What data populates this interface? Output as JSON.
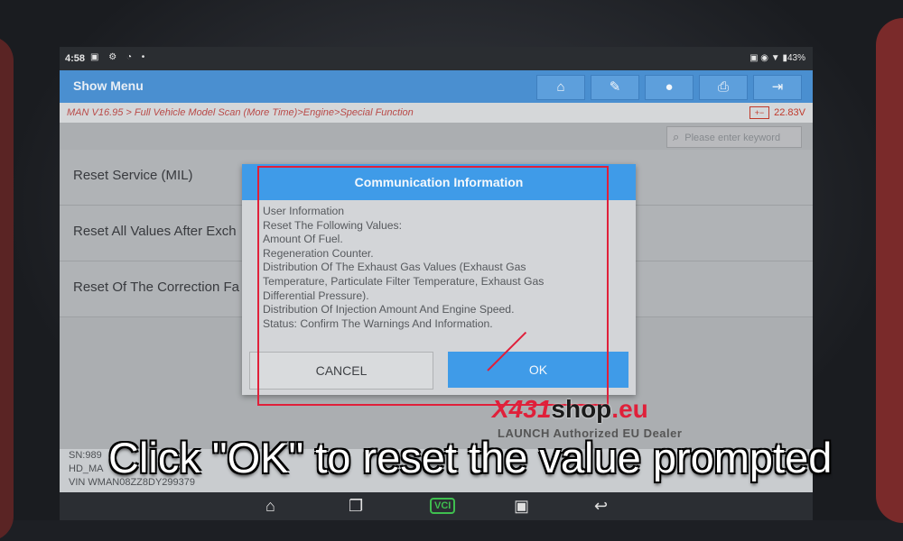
{
  "status_bar": {
    "time": "4:58",
    "left_icons": "▣ ⚙ ◔ •",
    "right_icons": "▣ ◉ ▼ ▮43%"
  },
  "header": {
    "title": "Show Menu",
    "buttons": [
      {
        "icon": "home-icon",
        "glyph": "⌂"
      },
      {
        "icon": "edit-report-icon",
        "glyph": "✎"
      },
      {
        "icon": "chat-icon",
        "glyph": "●"
      },
      {
        "icon": "print-icon",
        "glyph": "⎙"
      },
      {
        "icon": "exit-icon",
        "glyph": "⇥"
      }
    ]
  },
  "breadcrumb": {
    "path": "MAN V16.95 > Full Vehicle Model Scan (More Time)>Engine>Special Function",
    "battery_label": "+−",
    "voltage": "22.83V"
  },
  "search": {
    "placeholder": "Please enter keyword"
  },
  "menu_items": [
    {
      "label": "Reset Service (MIL)"
    },
    {
      "label": "Reset All Values After Exch"
    },
    {
      "label": "Reset Of The Correction Fa"
    }
  ],
  "vehicle_info": {
    "sn": "SN:989",
    "hd": "HD_MA",
    "vin": "VIN WMAN08ZZ8DY299379"
  },
  "dialog": {
    "title": "Communication Information",
    "lines": [
      "User Information",
      "Reset The Following Values:",
      "Amount Of Fuel.",
      "Regeneration Counter.",
      "Distribution Of The Exhaust Gas Values (Exhaust Gas",
      "Temperature, Particulate Filter Temperature, Exhaust Gas",
      "Differential Pressure).",
      "Distribution Of Injection Amount And Engine Speed.",
      "Status: Confirm The Warnings And Information."
    ],
    "cancel_label": "CANCEL",
    "ok_label": "OK"
  },
  "nav_bar": {
    "vci_label": "VCI"
  },
  "watermark": {
    "brand_x": "X431",
    "brand_shop": "shop",
    "brand_eu": ".eu",
    "dealer": "LAUNCH Authorized EU Dealer"
  },
  "caption": "Click \"OK\" to reset the value prompted",
  "colors": {
    "header_blue": "#4a8fd0",
    "dialog_blue": "#3f9be8",
    "highlight_red": "#e0203a"
  }
}
